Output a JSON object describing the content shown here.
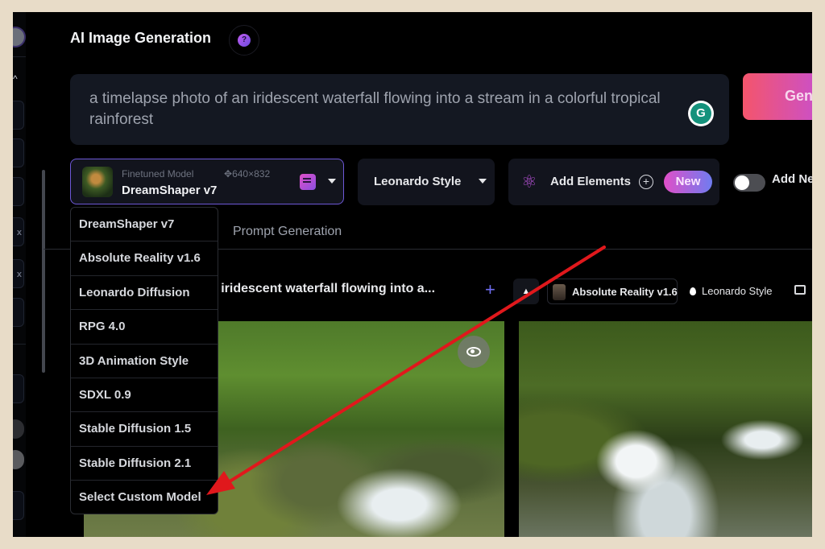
{
  "page": {
    "title": "AI Image Generation",
    "help_icon": "question-icon"
  },
  "prompt": {
    "value": "a timelapse photo of an iridescent waterfall flowing into a stream in a colorful tropical rainforest",
    "grammarly_icon": "grammarly-icon"
  },
  "generate_button": {
    "label": "Gen"
  },
  "model_selector": {
    "sublabel": "Finetuned Model",
    "dimensions": "640×832",
    "dimensions_icon": "move-icon",
    "selected": "DreamShaper v7"
  },
  "style_selector": {
    "selected": "Leonardo Style"
  },
  "elements": {
    "label": "Add Elements",
    "badge": "New"
  },
  "toggle": {
    "label": "Add Ne",
    "on": false
  },
  "tabs": {
    "prompt_generation": "Prompt Generation"
  },
  "dropdown": {
    "items": [
      "DreamShaper v7",
      "Absolute Reality v1.6",
      "Leonardo Diffusion",
      "RPG 4.0",
      "3D Animation Style",
      "SDXL 0.9",
      "Stable Diffusion 1.5",
      "Stable Diffusion 2.1",
      "Select Custom Model"
    ]
  },
  "generation_row": {
    "title": "n iridescent waterfall flowing into a...",
    "plus": "+",
    "model": "Absolute Reality v1.6",
    "style": "Leonardo Style",
    "up_icon": "▲"
  },
  "sidebar": {
    "chevron": "^",
    "box_labels": [
      "x",
      "x"
    ]
  },
  "annotation": {
    "arrow_color": "#e0181c"
  }
}
